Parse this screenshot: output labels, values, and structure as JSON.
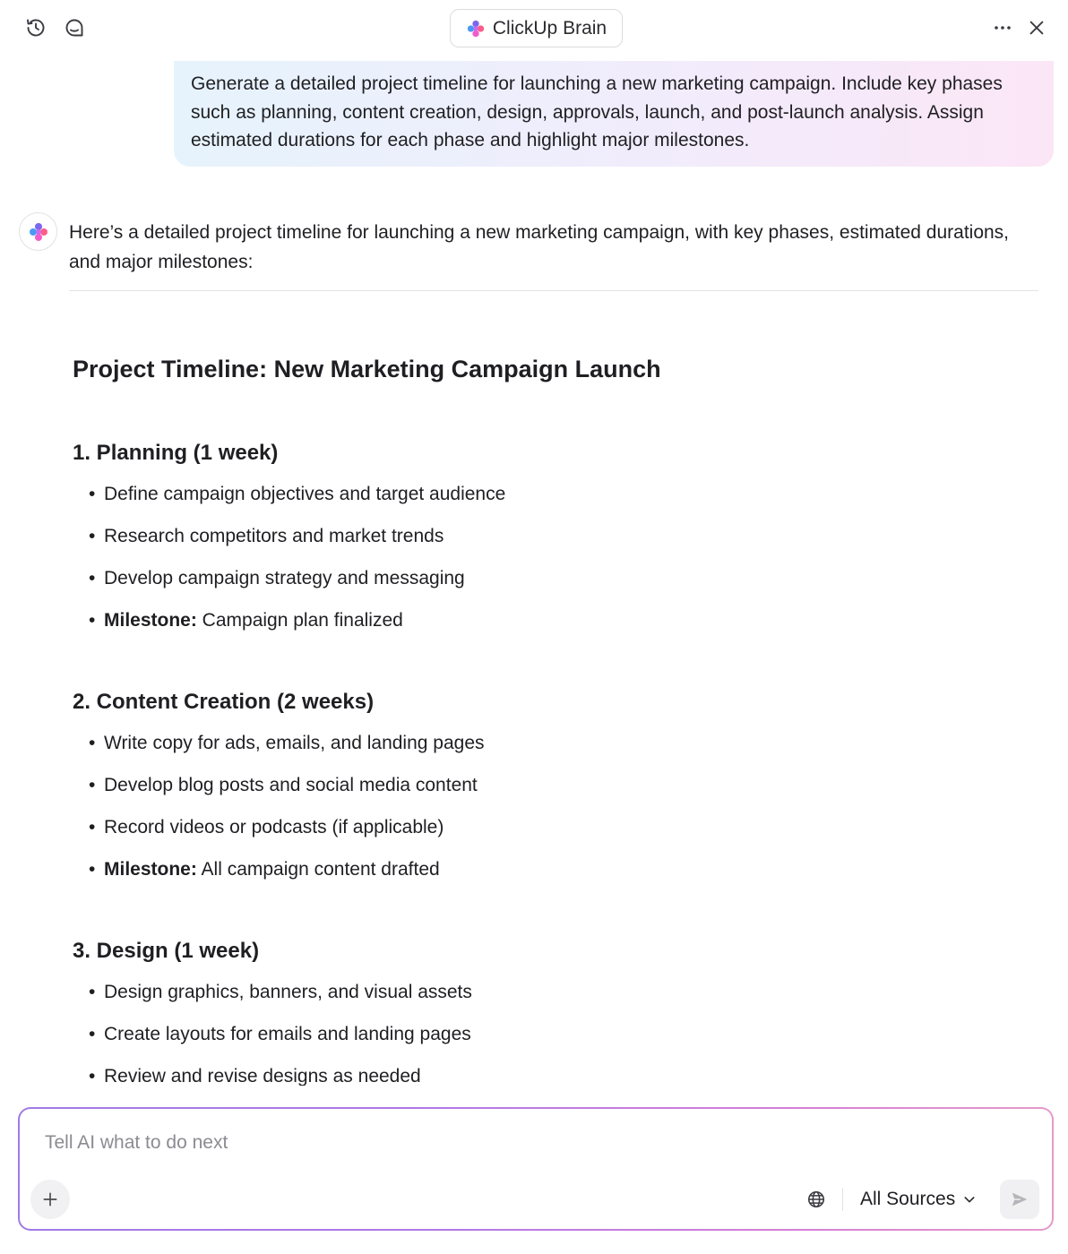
{
  "header": {
    "title": "ClickUp Brain",
    "left_icons": [
      "history-icon",
      "inbox-icon"
    ],
    "right_icons": [
      "more-icon",
      "close-icon"
    ]
  },
  "user_message": "Generate a detailed project timeline for launching a new marketing campaign. Include key phases such as planning, content creation, design, approvals, launch, and post-launch analysis. Assign estimated durations for each phase and highlight major milestones.",
  "assistant": {
    "intro": "Here’s a detailed project timeline for launching a new marketing campaign, with key phases, estimated durations, and major milestones:",
    "doc_title": "Project Timeline: New Marketing Campaign Launch",
    "phases": [
      {
        "title": "1. Planning (1 week)",
        "items": [
          {
            "text": "Define campaign objectives and target audience"
          },
          {
            "text": "Research competitors and market trends"
          },
          {
            "text": "Develop campaign strategy and messaging"
          },
          {
            "label": "Milestone:",
            "text": " Campaign plan finalized"
          }
        ]
      },
      {
        "title": "2. Content Creation (2 weeks)",
        "items": [
          {
            "text": "Write copy for ads, emails, and landing pages"
          },
          {
            "text": "Develop blog posts and social media content"
          },
          {
            "text": "Record videos or podcasts (if applicable)"
          },
          {
            "label": "Milestone:",
            "text": " All campaign content drafted"
          }
        ]
      },
      {
        "title": "3. Design (1 week)",
        "items": [
          {
            "text": "Design graphics, banners, and visual assets"
          },
          {
            "text": "Create layouts for emails and landing pages"
          },
          {
            "text": "Review and revise designs as needed"
          }
        ]
      }
    ]
  },
  "composer": {
    "placeholder": "Tell AI what to do next",
    "sources_label": "All Sources",
    "icons": [
      "plus-icon",
      "globe-icon",
      "chevron-down-icon",
      "send-icon"
    ]
  },
  "colors": {
    "bubble_gradient": [
      "#e6f3fc",
      "#f1ecfc",
      "#fbe6f6"
    ],
    "composer_border": [
      "#a07ae6",
      "#d57fd6",
      "#e59acb"
    ],
    "text": "#1f1f23"
  }
}
